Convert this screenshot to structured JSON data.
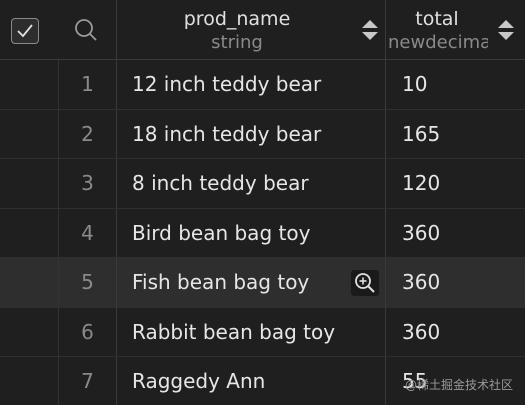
{
  "header": {
    "columns": [
      {
        "name": "prod_name",
        "type": "string"
      },
      {
        "name": "total",
        "type": "newdecima"
      }
    ]
  },
  "rows": [
    {
      "index": "1",
      "prod_name": "12 inch teddy bear",
      "total": "10"
    },
    {
      "index": "2",
      "prod_name": "18 inch teddy bear",
      "total": "165"
    },
    {
      "index": "3",
      "prod_name": "8 inch teddy bear",
      "total": "120"
    },
    {
      "index": "4",
      "prod_name": "Bird bean bag toy",
      "total": "360"
    },
    {
      "index": "5",
      "prod_name": "Fish bean bag toy",
      "total": "360"
    },
    {
      "index": "6",
      "prod_name": "Rabbit bean bag toy",
      "total": "360"
    },
    {
      "index": "7",
      "prod_name": "Raggedy Ann",
      "total": "55"
    }
  ],
  "hovered_row": 4,
  "watermark": "@稀土掘金技术社区",
  "colors": {
    "background": "#1f1f1f",
    "hover_row": "#2e2e2e",
    "text": "#e6e6e6",
    "muted": "#8a8a8a"
  },
  "icons": [
    "select-all-checkbox",
    "search-icon",
    "sort-icon",
    "zoom-in-icon"
  ]
}
